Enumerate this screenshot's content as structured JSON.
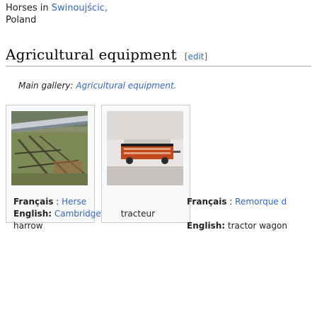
{
  "top_caption": {
    "line1_prefix": "Horses in ",
    "place": "Swinoujścic,",
    "line2": "Poland"
  },
  "section": {
    "title": "Agricultural equipment",
    "edit_open": "[",
    "edit_label": "edit",
    "edit_close": "]"
  },
  "hatnote": {
    "prefix": "Main gallery: ",
    "link": "Agricultural equipment."
  },
  "gallery": [
    {
      "fr_label": "Français",
      "fr_sep": " : ",
      "fr_value": "Herse",
      "en_label": "English:",
      "en_value": " Cambridge",
      "extra_line": "harrow",
      "mid_word": "tracteur"
    },
    {
      "fr_label": "Français",
      "fr_sep": " : ",
      "fr_value": "Remorque d",
      "en_label": "English:",
      "en_value": " tractor wagon"
    }
  ],
  "colors": {
    "link": "#3366cc",
    "border": "#c8ccd1",
    "rule": "#a2a9b1"
  },
  "icons": [
    "harrow-photo",
    "tractor-wagon-photo"
  ]
}
